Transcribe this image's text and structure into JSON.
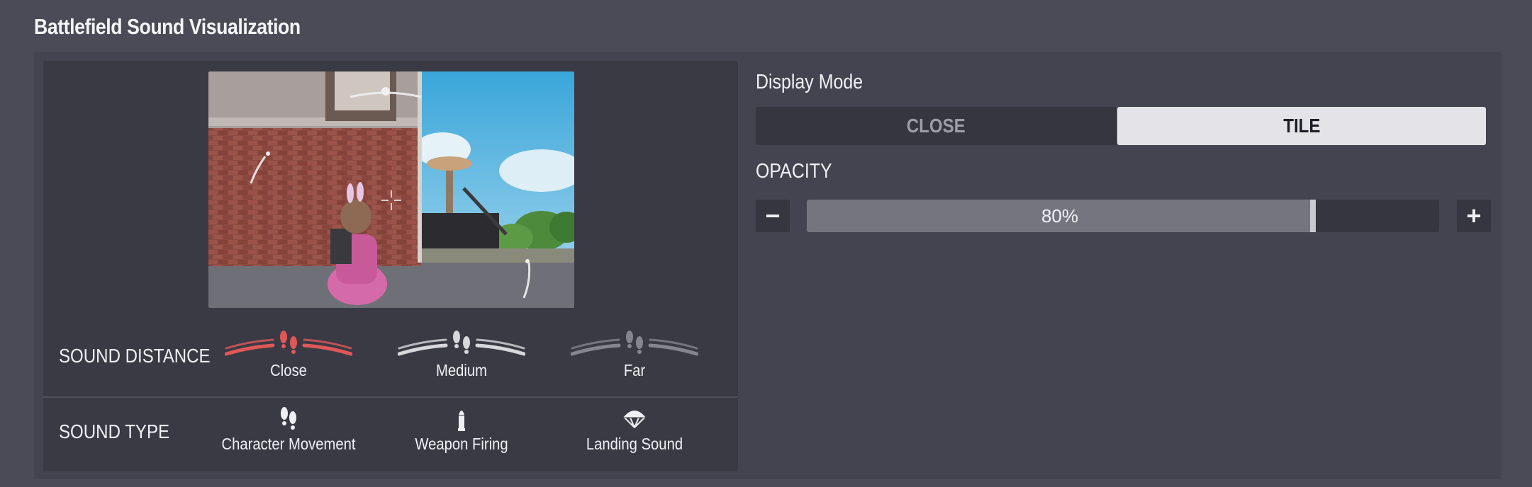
{
  "page": {
    "title": "Battlefield Sound Visualization"
  },
  "sound_distance": {
    "label": "SOUND DISTANCE",
    "options": [
      {
        "label": "Close",
        "color": "#e05757",
        "icon": "footsteps-icon"
      },
      {
        "label": "Medium",
        "color": "#d8d8dc",
        "icon": "footsteps-icon"
      },
      {
        "label": "Far",
        "color": "#85858d",
        "icon": "footsteps-icon"
      }
    ]
  },
  "sound_type": {
    "label": "SOUND TYPE",
    "options": [
      {
        "label": "Character Movement",
        "icon": "footsteps-icon"
      },
      {
        "label": "Weapon Firing",
        "icon": "bullet-icon"
      },
      {
        "label": "Landing Sound",
        "icon": "parachute-icon"
      }
    ]
  },
  "display_mode": {
    "label": "Display Mode",
    "options": [
      "CLOSE",
      "TILE"
    ],
    "selected": "TILE"
  },
  "opacity": {
    "label": "OPACITY",
    "value_text": "80%",
    "value": 0.8,
    "decrement_label": "−",
    "increment_label": "+"
  },
  "colors": {
    "accent_close": "#e05757",
    "selected_segment": "#e4e4e8"
  }
}
